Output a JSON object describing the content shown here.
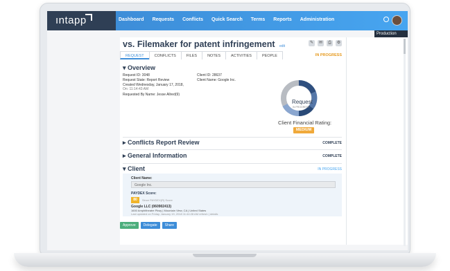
{
  "header": {
    "logo_text": "ıntapp",
    "nav": [
      "Dashboard",
      "Requests",
      "Conflicts",
      "Quick Search",
      "Terms",
      "Reports",
      "Administration"
    ],
    "environment": "Production"
  },
  "page": {
    "title": "vs. Filemaker for patent infringement",
    "edit_link": "edit",
    "status": "IN PROGRESS",
    "tabs": [
      "REQUEST",
      "CONFLICTS",
      "FILES",
      "NOTES",
      "ACTIVITIES",
      "PEOPLE"
    ]
  },
  "overview": {
    "title": "▾ Overview",
    "request_id": "Request ID:  3048",
    "request_state": "Request State:  Report Review",
    "created": "Created        Wednesday, January 17, 2018,",
    "created_time": "On:              11:14:43 AM",
    "requested_by": "Requested By Name:  Jesse Allred(9)",
    "client_id": "Client ID:  28637",
    "client_name": "Client Name:  Google Inc.",
    "donut_label": "Request",
    "donut_sub": "IN PROGRESS",
    "rating_label": "Client Financial Rating:",
    "rating_value": "MEDIUM"
  },
  "sections": [
    {
      "title": "▸ Conflicts Report Review",
      "status": "COMPLETE"
    },
    {
      "title": "▸ General Information",
      "status": "COMPLETE"
    },
    {
      "title": "▾ Client",
      "status": "IN PROGRESS"
    }
  ],
  "client": {
    "name_label": "Client Name:",
    "name_value": "Google Inc.",
    "paydex_label": "PAYDEX Score:",
    "paydex_value": "80",
    "paydex_note": "Since PAYDEX(R) Score",
    "company": "Google LLC (060902413)",
    "address": "1600 Amphitheatre Pkwy | Mountain View, CA | United States",
    "updated": "Last updated on Friday, January 19, 2018 11:44:28 AM   refresh  |  details"
  },
  "buttons": [
    "Approve",
    "Delegate",
    "Share"
  ],
  "colors": {
    "nav_dark": "#2f3f55",
    "nav_blue": "#47a5f0",
    "in_progress": "#e69a1e",
    "complete": "#2f3f55",
    "rating": "#f0a93a",
    "approve": "#4cae7c",
    "delegate": "#3d8dd8",
    "share": "#3d8dd8"
  }
}
